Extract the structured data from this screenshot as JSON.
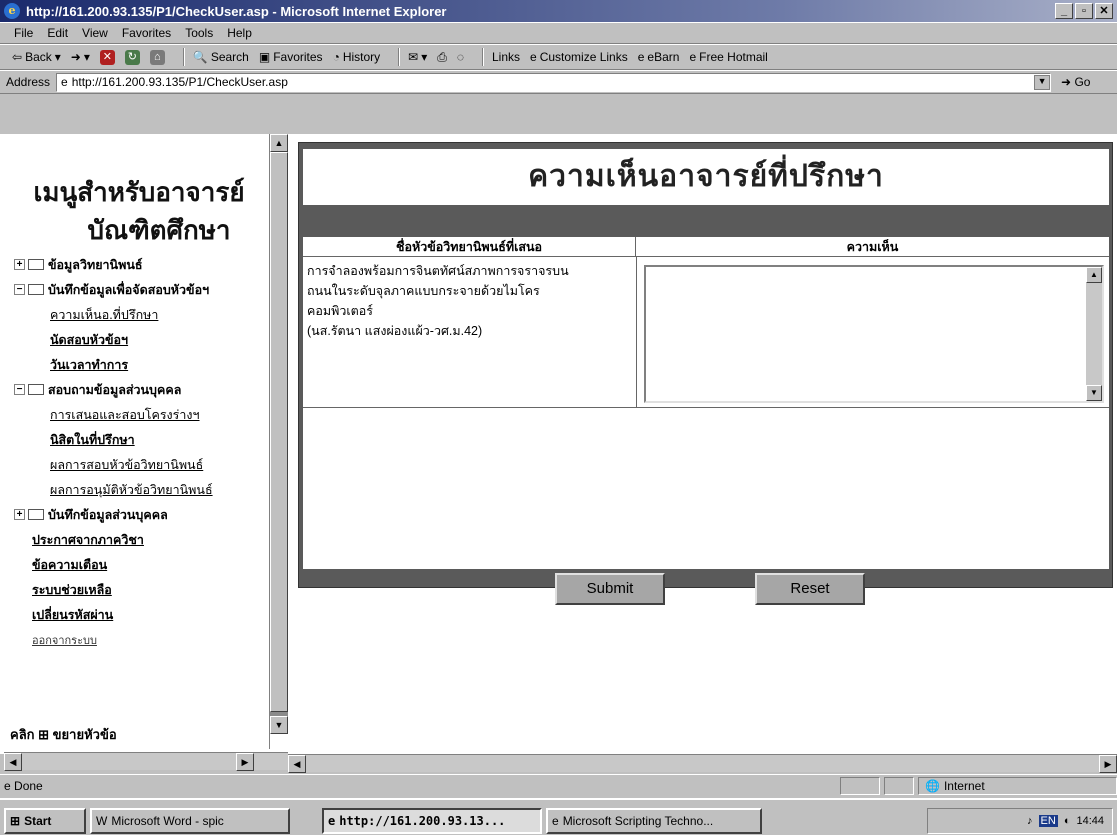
{
  "window": {
    "title": "http://161.200.93.135/P1/CheckUser.asp - Microsoft Internet Explorer"
  },
  "menu": [
    "File",
    "Edit",
    "View",
    "Favorites",
    "Tools",
    "Help"
  ],
  "toolbar": {
    "back": "Back",
    "search": "Search",
    "favorites": "Favorites",
    "history": "History",
    "links": "Links",
    "customize_links": "Customize Links",
    "ebarn": "eBarn",
    "free_hotmail": "Free Hotmail"
  },
  "address": {
    "label": "Address",
    "url": "http://161.200.93.135/P1/CheckUser.asp",
    "go": "Go"
  },
  "left_menu": {
    "title_line1": "เมนูสำหรับอาจารย์",
    "title_line2": "บัณฑิตศึกษา",
    "items": [
      {
        "label": "ข้อมูลวิทยานิพนธ์"
      },
      {
        "label": "บันทึกข้อมูลเพื่อจัดสอบหัวข้อฯ"
      },
      {
        "label": "ความเห็นอ.ที่ปรึกษา"
      },
      {
        "label": "นัดสอบหัวข้อฯ"
      },
      {
        "label": "วันเวลาทำการ"
      },
      {
        "label": "สอบถามข้อมูลส่วนบุคคล"
      },
      {
        "label": "การเสนอและสอบโครงร่างฯ"
      },
      {
        "label": "นิสิตในที่ปรึกษา"
      },
      {
        "label": "ผลการสอบหัวข้อวิทยานิพนธ์"
      },
      {
        "label": "ผลการอนุมัติหัวข้อวิทยานิพนธ์"
      },
      {
        "label": "บันทึกข้อมูลส่วนบุคคล"
      },
      {
        "label": "ประกาศจากภาควิชา"
      },
      {
        "label": "ข้อความเตือน"
      },
      {
        "label": "ระบบช่วยเหลือ"
      },
      {
        "label": "เปลี่ยนรหัสผ่าน"
      },
      {
        "label": "ออกจากระบบ"
      }
    ],
    "bottom_text": "คลิก ⊞ ขยายหัวข้อ"
  },
  "main": {
    "heading": "ความเห็นอาจารย์ที่ปรึกษา",
    "col1_header": "ชื่อหัวข้อวิทยานิพนธ์ที่เสนอ",
    "col2_header": "ความเห็น",
    "thesis_line1": "การจำลองพร้อมการจินตทัศน์สภาพการจราจรบน",
    "thesis_line2": "ถนนในระดับจุลภาคแบบกระจายด้วยไมโคร",
    "thesis_line3": "คอมพิวเตอร์",
    "thesis_line4": "(นส.รัตนา แสงผ่องแผ้ว-วศ.ม.42)",
    "comment_value": "",
    "submit": "Submit",
    "reset": "Reset"
  },
  "status": {
    "text": "Done",
    "zone": "Internet"
  },
  "taskbar": {
    "start": "Start",
    "tasks": [
      "Microsoft Word - spic",
      "http://161.200.93.13...",
      "Microsoft Scripting Techno..."
    ],
    "clock": "14:44",
    "lang": "EN"
  }
}
